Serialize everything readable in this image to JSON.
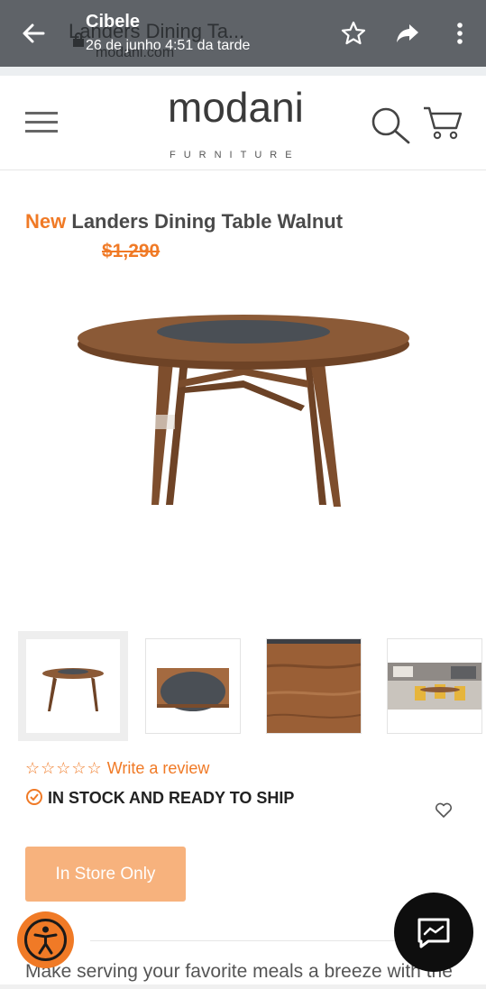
{
  "notification": {
    "sender": "Cibele",
    "timestamp": "26 de junho 4:51 da tarde",
    "page_title": "Landers Dining Ta...",
    "page_domain": "modani.com"
  },
  "site": {
    "logo_word": "modani",
    "logo_sub": "FURNITURE"
  },
  "product": {
    "badge": "New",
    "name": "Landers Dining Table Walnut",
    "old_price": "$1,290",
    "rating_stars": "☆☆☆☆☆",
    "review_link": "Write a review",
    "stock_status": "IN STOCK AND READY TO SHIP",
    "store_button": "In Store Only",
    "description": "Make serving your favorite meals a breeze with the"
  },
  "colors": {
    "accent": "#f07a26",
    "button_disabled": "#f7b27d",
    "walnut": "#8b5a37",
    "lazy_susan": "#4a4f55",
    "top_bar": "#5f6368"
  },
  "icons": [
    "back-arrow-icon",
    "lock-icon",
    "star-icon",
    "share-icon",
    "more-vert-icon",
    "hamburger-menu-icon",
    "search-icon",
    "cart-icon",
    "check-circle-icon",
    "heart-icon",
    "accessibility-icon",
    "chat-icon"
  ]
}
